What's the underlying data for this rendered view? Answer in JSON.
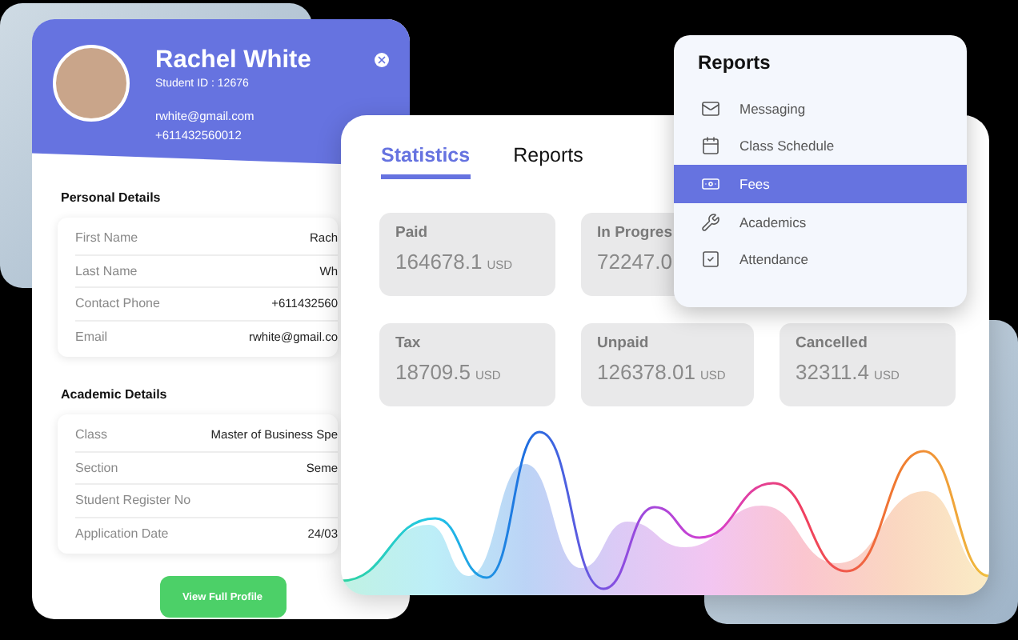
{
  "profile": {
    "name": "Rachel White",
    "student_id": "Student ID : 12676",
    "email": "rwhite@gmail.com",
    "phone": "+611432560012",
    "sections": [
      {
        "title": "Personal Details",
        "rows": [
          {
            "label": "First Name",
            "value": "Rach"
          },
          {
            "label": "Last Name",
            "value": "Wh"
          },
          {
            "label": "Contact Phone",
            "value": "+611432560"
          },
          {
            "label": "Email",
            "value": "rwhite@gmail.co"
          }
        ]
      },
      {
        "title": "Academic Details",
        "rows": [
          {
            "label": "Class",
            "value": "Master of Business Spe"
          },
          {
            "label": "Section",
            "value": "Seme"
          },
          {
            "label": "Student Register No"
          },
          {
            "label": "Application Date",
            "value": "24/03"
          }
        ]
      }
    ],
    "button": "View Full Profile"
  },
  "statistics": {
    "tabs": [
      {
        "label": "Statistics",
        "selected": true
      },
      {
        "label": "Reports",
        "selected": false
      }
    ],
    "stat_rows": [
      [
        {
          "label": "Paid",
          "value": "164678.1",
          "unit": "USD"
        },
        {
          "label": "In Progres",
          "value": "72247.0"
        }
      ],
      [
        {
          "label": "Tax",
          "value": "18709.5",
          "unit": "USD"
        },
        {
          "label": "Unpaid",
          "value": "126378.01",
          "unit": "USD"
        },
        {
          "label": "Cancelled",
          "value": "32311.4",
          "unit": "USD"
        }
      ]
    ]
  },
  "reports_menu": {
    "title": "Reports",
    "items": [
      {
        "label": "Messaging",
        "kind": "mail",
        "selected": false
      },
      {
        "label": "Class Schedule",
        "kind": "calendar",
        "selected": false
      },
      {
        "label": "Fees",
        "kind": "money",
        "selected": true
      },
      {
        "label": "Academics",
        "kind": "wrench",
        "selected": false
      },
      {
        "label": "Attendance",
        "kind": "check",
        "selected": false
      }
    ]
  }
}
